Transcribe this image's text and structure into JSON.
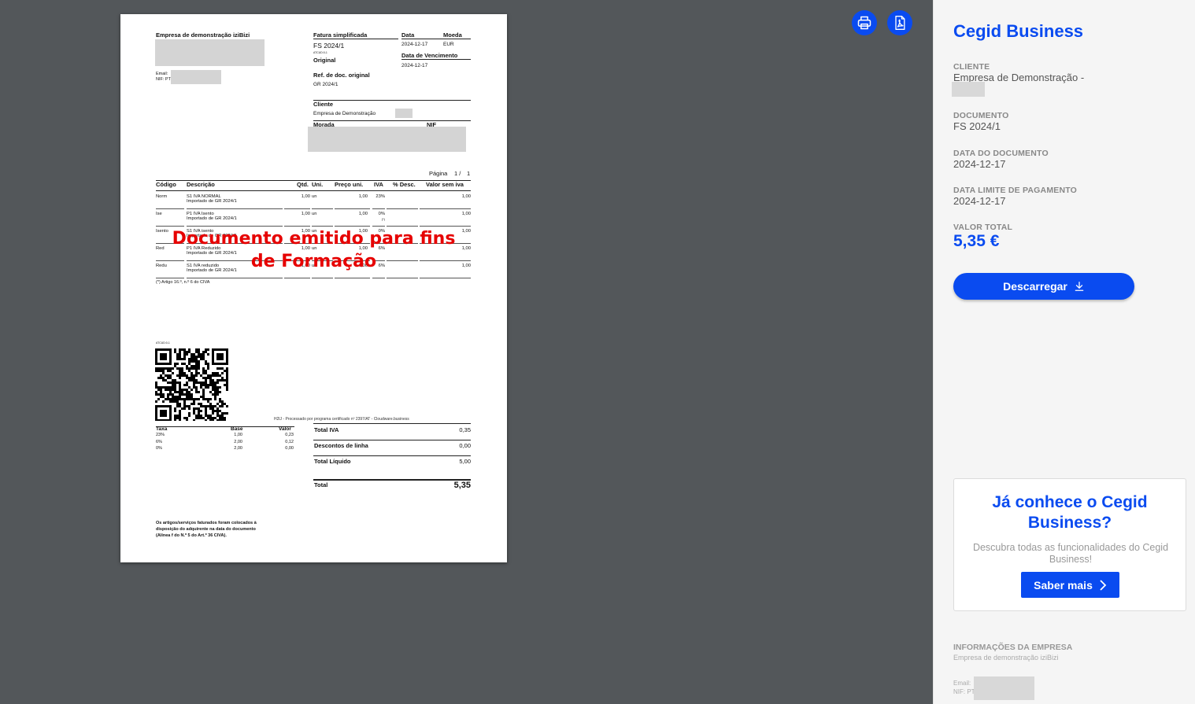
{
  "toolbar": {
    "print_icon": "printer-icon",
    "pdf_icon": "pdf-file-icon"
  },
  "invoice": {
    "company_name": "Empresa de demonstração iziBizi",
    "email_label": "Email:",
    "nif_label": "NIF: PT",
    "doc_type_label": "Fatura simplificada",
    "doc_number": "FS 2024/1",
    "atcud": "ATCUD:0-1",
    "copy": "Original",
    "date_label": "Data",
    "date_value": "2024-12-17",
    "currency_label": "Moeda",
    "currency_value": "EUR",
    "due_label": "Data de Vencimento",
    "due_value": "2024-12-17",
    "ref_label": "Ref. de doc. original",
    "ref_value": "GR 2024/1",
    "client_label": "Cliente",
    "client_value": "Empresa de Demonstração",
    "address_label": "Morada",
    "nif_col_label": "NIF",
    "page_label": "Página",
    "page_value": "1 /",
    "page_total": "1",
    "headers": [
      "Código",
      "Descrição",
      "Qtd.",
      "Uni.",
      "Preço uni.",
      "IVA",
      "% Desc.",
      "Valor sem iva"
    ],
    "rows": [
      {
        "code": "Norm",
        "desc": "S1 IVA NORMAL",
        "sub": "Importado de GR 2024/1",
        "qty": "1,00",
        "unit": "un",
        "price": "1,00",
        "vat": "23%",
        "note": "",
        "value": "1,00"
      },
      {
        "code": "Ise",
        "desc": "P1 IVA Isento",
        "sub": "Importado de GR 2024/1",
        "qty": "1,00",
        "unit": "un",
        "price": "1,00",
        "vat": "0%",
        "note": "(*)",
        "value": "1,00"
      },
      {
        "code": "Isento",
        "desc": "S1 IVA isento",
        "sub": "Importado de GR 2024/1",
        "qty": "1,00",
        "unit": "un",
        "price": "1,00",
        "vat": "0%",
        "note": "",
        "value": "1,00"
      },
      {
        "code": "Red",
        "desc": "P1 IVA Reduzido",
        "sub": "Importado de GR 2024/1",
        "qty": "1,00",
        "unit": "un",
        "price": "1,00",
        "vat": "6%",
        "note": "",
        "value": "1,00"
      },
      {
        "code": "Redu",
        "desc": "S1 IVA reduzido",
        "sub": "Importado de GR 2024/1",
        "qty": "1,00",
        "unit": "un",
        "price": "1,00",
        "vat": "6%",
        "note": "",
        "value": "1,00"
      }
    ],
    "footnote": "(*) Artigo 16.º, n.º 6 do CIVA",
    "watermark_line1": "Documento emitido para fins",
    "watermark_line2": "de Formação",
    "qr_atcud": "ATCUD:0-1",
    "processed": "H2lJ - Processado por programa certificado nº 2397/AT - Cloudware.business",
    "tax_headers": [
      "Taxa",
      "Base",
      "Valor"
    ],
    "tax_rows": [
      {
        "rate": "23%",
        "base": "1,00",
        "value": "0,23"
      },
      {
        "rate": "6%",
        "base": "2,00",
        "value": "0,12"
      },
      {
        "rate": "0%",
        "base": "2,00",
        "value": "0,00"
      }
    ],
    "total_iva_label": "Total IVA",
    "total_iva": "0,35",
    "descontos_label": "Descontos de linha",
    "descontos": "0,00",
    "liquido_label": "Total Líquido",
    "liquido": "5,00",
    "total_label": "Total",
    "total": "5,35",
    "legal_line1": "Os artigos/serviços faturados foram colocados à",
    "legal_line2": "disposição do adquirente na data do documento",
    "legal_line3": "(Alínea f do N.º 5 do Art.º 36 CIVA)."
  },
  "sidebar": {
    "brand": "Cegid Business",
    "client_label": "CLIENTE",
    "client_value": "Empresa de Demonstração -",
    "doc_label": "DOCUMENTO",
    "doc_value": "FS 2024/1",
    "date_label": "DATA DO DOCUMENTO",
    "date_value": "2024-12-17",
    "due_label": "DATA LIMITE DE PAGAMENTO",
    "due_value": "2024-12-17",
    "total_label": "VALOR TOTAL",
    "total_value": "5,35 €",
    "download_label": "Descarregar",
    "promo_title": "Já conhece o Cegid Business?",
    "promo_text": "Descubra todas as funcionalidades do Cegid Business!",
    "promo_button": "Saber mais",
    "company_info_label": "INFORMAÇÕES DA EMPRESA",
    "company_name": "Empresa de demonstração iziBizi",
    "email_label": "Email:",
    "nif_label": "NIF: PT"
  },
  "colors": {
    "accent": "#0a4bf0",
    "watermark": "#e60000",
    "viewer_bg": "#53575a",
    "sidebar_bg": "#f5f5f5"
  }
}
